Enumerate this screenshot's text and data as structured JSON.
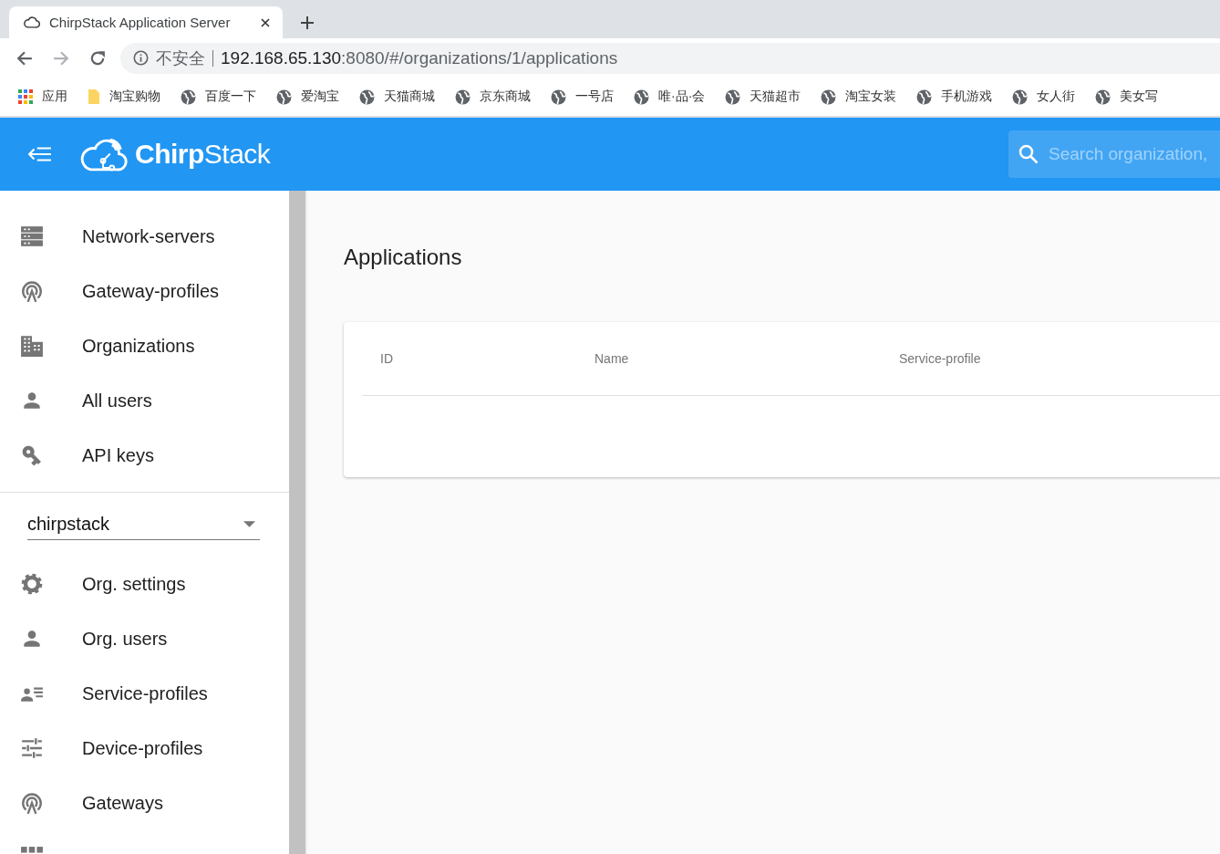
{
  "browser": {
    "tab_title": "ChirpStack Application Server",
    "security_label": "不安全",
    "url_host": "192.168.65.130",
    "url_path": ":8080/#/organizations/1/applications"
  },
  "bookmarks": [
    {
      "kind": "apps",
      "label": "应用"
    },
    {
      "kind": "folder",
      "label": "淘宝购物"
    },
    {
      "kind": "globe",
      "label": "百度一下"
    },
    {
      "kind": "globe",
      "label": "爱淘宝"
    },
    {
      "kind": "globe",
      "label": "天猫商城"
    },
    {
      "kind": "globe",
      "label": "京东商城"
    },
    {
      "kind": "globe",
      "label": "一号店"
    },
    {
      "kind": "globe",
      "label": "唯·品·会"
    },
    {
      "kind": "globe",
      "label": "天猫超市"
    },
    {
      "kind": "globe",
      "label": "淘宝女装"
    },
    {
      "kind": "globe",
      "label": "手机游戏"
    },
    {
      "kind": "globe",
      "label": "女人街"
    },
    {
      "kind": "globe",
      "label": "美女写"
    }
  ],
  "app_bar": {
    "logo": "**Chirp**Stack",
    "search": {
      "placeholder": "Search organization,"
    }
  },
  "sidebar": {
    "admin_items": [
      {
        "kind": "servers",
        "label": "Network-servers"
      },
      {
        "kind": "antenna",
        "label": "Gateway-profiles"
      },
      {
        "kind": "building",
        "label": "Organizations"
      },
      {
        "kind": "person",
        "label": "All users"
      },
      {
        "kind": "key",
        "label": "API keys"
      }
    ],
    "organization_select": {
      "value": "chirpstack"
    },
    "org_items": [
      {
        "kind": "gear",
        "label": "Org. settings"
      },
      {
        "kind": "person",
        "label": "Org. users"
      },
      {
        "kind": "person-list",
        "label": "Service-profiles"
      },
      {
        "kind": "sliders",
        "label": "Device-profiles"
      },
      {
        "kind": "antenna",
        "label": "Gateways"
      },
      {
        "kind": "grid"
      }
    ]
  },
  "page": {
    "title": "Applications",
    "table": {
      "columns": [
        "ID",
        "Name",
        "Service-profile"
      ]
    }
  }
}
